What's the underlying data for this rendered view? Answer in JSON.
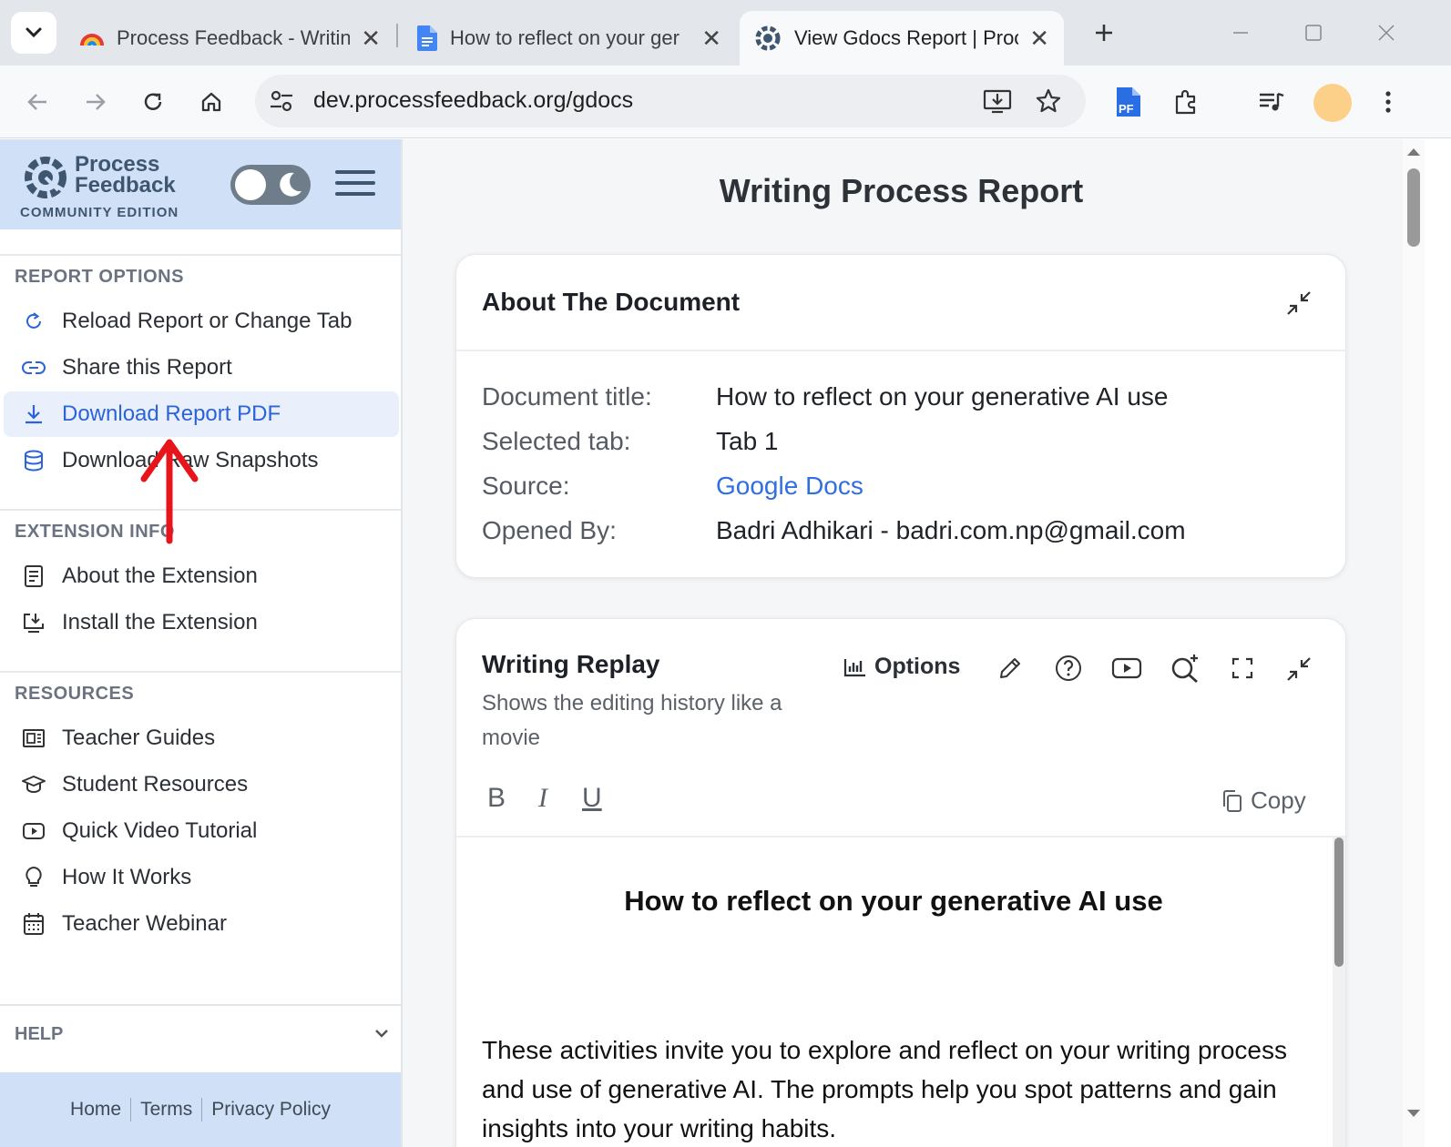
{
  "browser": {
    "tabs": [
      {
        "title": "Process Feedback - Writin",
        "close": "✕"
      },
      {
        "title": "How to reflect on your ger",
        "close": "✕"
      },
      {
        "title": "View Gdocs Report | Proce",
        "close": "✕"
      }
    ],
    "active_tab_index": 2,
    "url": "dev.processfeedback.org/gdocs"
  },
  "sidebar": {
    "brand_line1": "Process",
    "brand_line2": "Feedback",
    "edition": "COMMUNITY EDITION",
    "report_options": {
      "title": "REPORT OPTIONS",
      "items": [
        {
          "label": "Reload Report or Change Tab",
          "icon": "reload-icon"
        },
        {
          "label": "Share this Report",
          "icon": "link-icon"
        },
        {
          "label": "Download Report PDF",
          "icon": "download-icon"
        },
        {
          "label": "Download Raw Snapshots",
          "icon": "database-icon"
        }
      ]
    },
    "extension_info": {
      "title": "EXTENSION INFO",
      "items": [
        {
          "label": "About the Extension",
          "icon": "document-icon"
        },
        {
          "label": "Install the Extension",
          "icon": "install-icon"
        }
      ]
    },
    "resources": {
      "title": "RESOURCES",
      "items": [
        {
          "label": "Teacher Guides",
          "icon": "guide-icon"
        },
        {
          "label": "Student Resources",
          "icon": "graduation-cap-icon"
        },
        {
          "label": "Quick Video Tutorial",
          "icon": "video-icon"
        },
        {
          "label": "How It Works",
          "icon": "lightbulb-icon"
        },
        {
          "label": "Teacher Webinar",
          "icon": "calendar-icon"
        }
      ]
    },
    "help": {
      "title": "HELP"
    },
    "footer": {
      "home": "Home",
      "terms": "Terms",
      "privacy": "Privacy Policy"
    }
  },
  "main": {
    "page_title": "Writing Process Report",
    "about": {
      "title": "About The Document",
      "rows": [
        {
          "label": "Document title:",
          "value": "How to reflect on your generative AI use"
        },
        {
          "label": "Selected tab:",
          "value": "Tab 1"
        },
        {
          "label": "Source:",
          "value": "Google Docs"
        },
        {
          "label": "Opened By:",
          "value": "Badri Adhikari - badri.com.np@gmail.com"
        }
      ]
    },
    "replay": {
      "title": "Writing Replay",
      "subtitle": "Shows the editing history like a movie",
      "options_label": "Options",
      "bold": "B",
      "italic": "I",
      "underline": "U",
      "copy_label": "Copy",
      "doc_heading": "How to reflect on your generative AI use",
      "doc_body": "These activities invite you to explore and reflect on your writing process and use of generative AI. The prompts help you spot patterns and gain insights into your writing habits."
    }
  },
  "colors": {
    "accent": "#2f6fe0",
    "sidebar_header": "#cfe0f7",
    "annotation_arrow": "#e8141b"
  }
}
